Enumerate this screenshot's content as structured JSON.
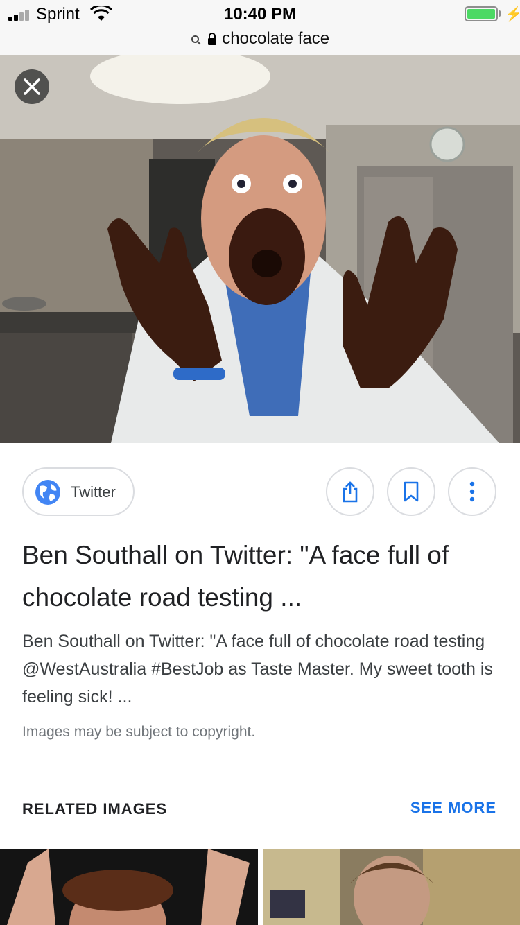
{
  "status_bar": {
    "carrier": "Sprint",
    "time": "10:40 PM"
  },
  "url_bar": {
    "query": "chocolate face"
  },
  "result": {
    "source_name": "Twitter",
    "title": "Ben Southall on Twitter: \"A face full of chocolate road testing ...",
    "snippet": "Ben Southall on Twitter: \"A face full of chocolate road testing @WestAustralia #BestJob as Taste Master. My sweet tooth is feeling sick! ...",
    "copyright_notice": "Images may be subject to copyright."
  },
  "related": {
    "heading": "RELATED IMAGES",
    "see_more_label": "SEE MORE"
  },
  "icons": {
    "close": "close-icon",
    "globe": "globe-icon",
    "share": "share-icon",
    "bookmark": "bookmark-icon",
    "more": "more-vert-icon",
    "search": "search-icon",
    "lock": "lock-icon"
  },
  "colors": {
    "accent": "#1a73e8",
    "battery": "#4cd964"
  }
}
